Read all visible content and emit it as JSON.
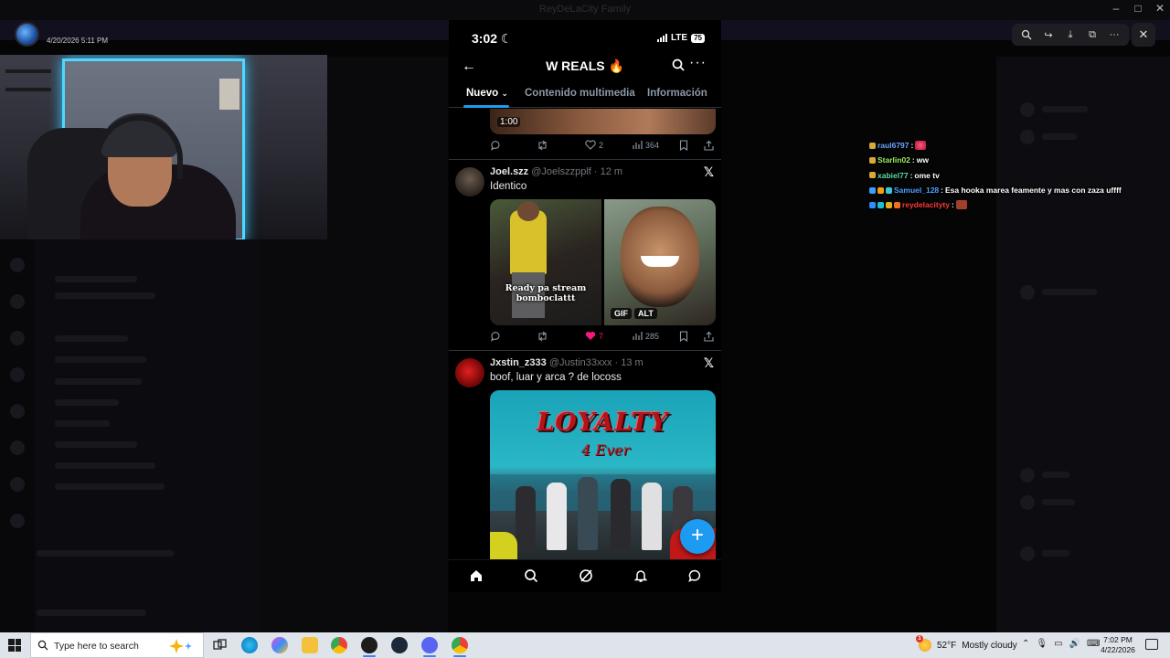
{
  "background": {
    "window_title": "ReyDeLaCity Family"
  },
  "streamer": {
    "date": "4/20/2026 5:11 PM"
  },
  "phone": {
    "status": {
      "time": "3:02",
      "network": "LTE",
      "battery": "75"
    },
    "header": {
      "title": "W REALS 🔥"
    },
    "tabs": [
      {
        "label": "Nuevo"
      },
      {
        "label": "Contenido multimedia"
      },
      {
        "label": "Información"
      }
    ],
    "top_media": {
      "duration": "1:00"
    },
    "top_actions": {
      "replies": "",
      "retweets": "",
      "likes": "2",
      "views": "364"
    },
    "tweets": [
      {
        "name": "Joel.szz",
        "handle": "@Joelszzpplf",
        "age": "· 12 m",
        "text": "Identico",
        "media_caption": "Ready pa stream bomboclattt",
        "badges": [
          "GIF",
          "ALT"
        ],
        "actions": {
          "likes": "7",
          "views": "285"
        }
      },
      {
        "name": "Jxstin_z333",
        "handle": "@Justin33xxx",
        "age": "· 13 m",
        "text": "boof, luar y arca ? de locoss",
        "album_title": "LOYALTY",
        "album_sub": "4 Ever"
      }
    ],
    "fab": "+"
  },
  "chat": [
    {
      "user": "raul6797",
      "color": "#6aa8ff",
      "message": "",
      "emote": "heart"
    },
    {
      "user": "Starlin02",
      "color": "#9bef61",
      "message": "ww"
    },
    {
      "user": "xabiel77",
      "color": "#57e0a6",
      "message": "ome tv"
    },
    {
      "user": "Samuel_128",
      "color": "#4ea1ff",
      "message": "Esa hooka marea feamente y mas con zaza uffff"
    },
    {
      "user": "reydelacityty",
      "color": "#ff3b3b",
      "message": "",
      "emote": "face"
    }
  ],
  "taskbar": {
    "search_placeholder": "Type here to search",
    "weather": {
      "temp": "52°F",
      "condition": "Mostly cloudy",
      "alert": "1"
    },
    "clock": {
      "time": "7:02 PM",
      "date": "4/22/2026"
    }
  },
  "colors": {
    "accent": "#1d9bf0",
    "like": "#f91880",
    "phone_bg": "#000000"
  }
}
